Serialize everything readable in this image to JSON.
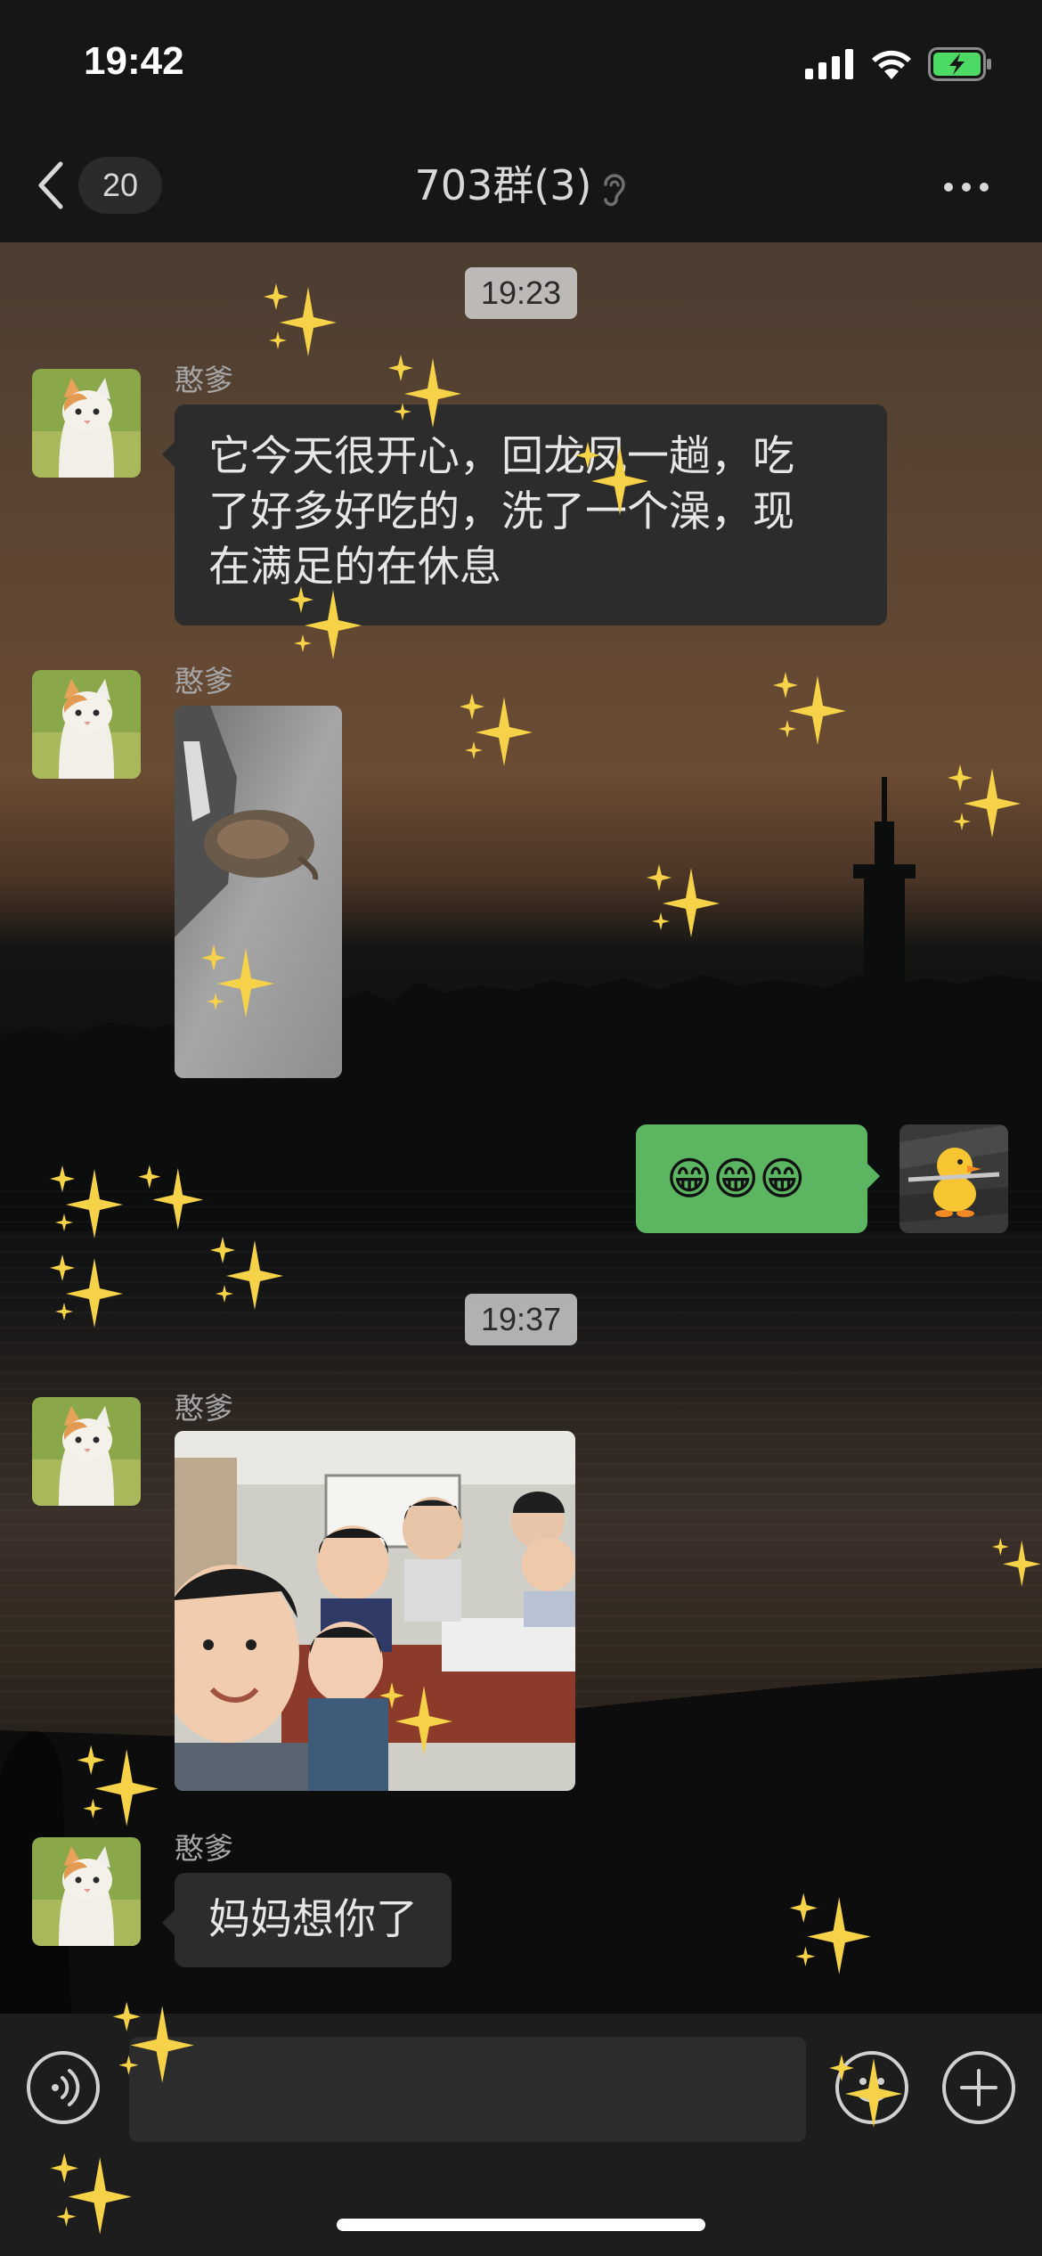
{
  "status_bar": {
    "time": "19:42"
  },
  "nav": {
    "unread_count": "20",
    "title": "703群(3)"
  },
  "messages": [
    {
      "type": "timestamp",
      "text": "19:23"
    },
    {
      "type": "text",
      "direction": "incoming",
      "sender": "憨爹",
      "text": "它今天很开心，回龙凤一趟，吃了好多好吃的，洗了一个澡，现在满足的在休息"
    },
    {
      "type": "image",
      "direction": "incoming",
      "sender": "憨爹",
      "image": "cat-sleeping-photo"
    },
    {
      "type": "text",
      "direction": "outgoing",
      "text": "😁😁😁"
    },
    {
      "type": "timestamp",
      "text": "19:37"
    },
    {
      "type": "image",
      "direction": "incoming",
      "sender": "憨爹",
      "image": "children-classroom-photo"
    },
    {
      "type": "text",
      "direction": "incoming",
      "sender": "憨爹",
      "text": "妈妈想你了"
    }
  ],
  "msg_text_1_lines": [
    "它今天很开心，回龙凤一趟，吃",
    "了好多好吃的，洗了一个澡，现",
    "在满足的在休息"
  ],
  "input": {
    "placeholder": ""
  },
  "colors": {
    "outgoing_bubble": "#5bb561",
    "incoming_bubble": "#2c2c2c",
    "battery": "#4cd964"
  }
}
